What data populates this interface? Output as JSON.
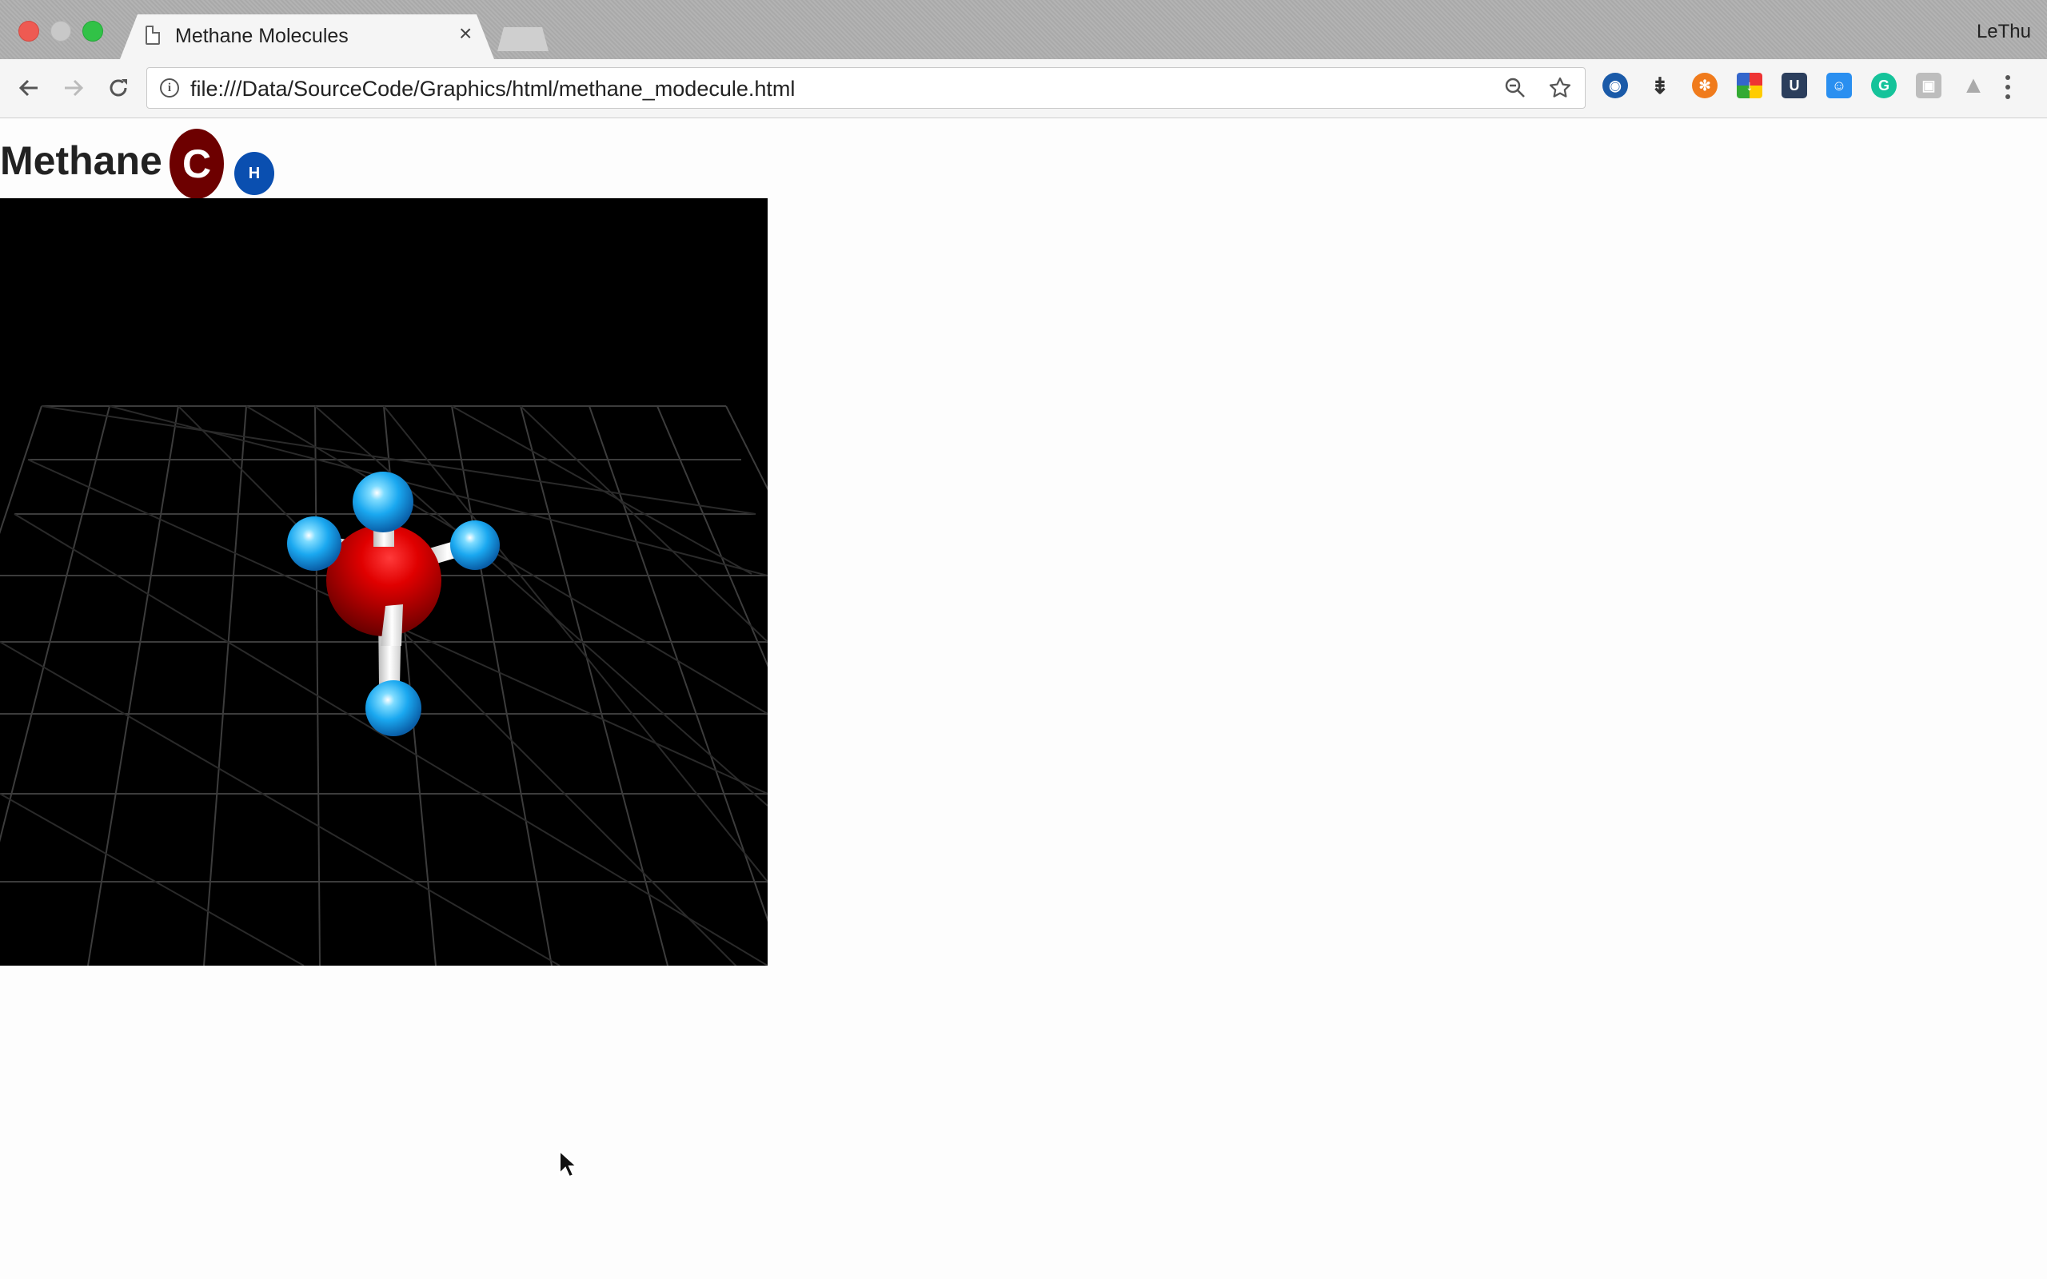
{
  "browser": {
    "tab_title": "Methane Molecules",
    "tab_close": "×",
    "profile_name": "LeThu",
    "url": "file:///Data/SourceCode/Graphics/html/methane_modecule.html",
    "info_icon": "i",
    "extensions": [
      "globe-icon",
      "traffic-light-icon",
      "orange-circle-icon",
      "colorful-icon",
      "u-box-icon",
      "dog-icon",
      "grammarly-icon",
      "android-icon",
      "drive-icon"
    ]
  },
  "page": {
    "title": "Methane",
    "carbon_badge": "C",
    "hydrogen_badge": "H"
  },
  "scene": {
    "background": "#000000",
    "grid_color": "#444444",
    "carbon_color": "#cc0000",
    "hydrogen_color": "#1aa8f0",
    "bond_color": "#ffffff"
  }
}
